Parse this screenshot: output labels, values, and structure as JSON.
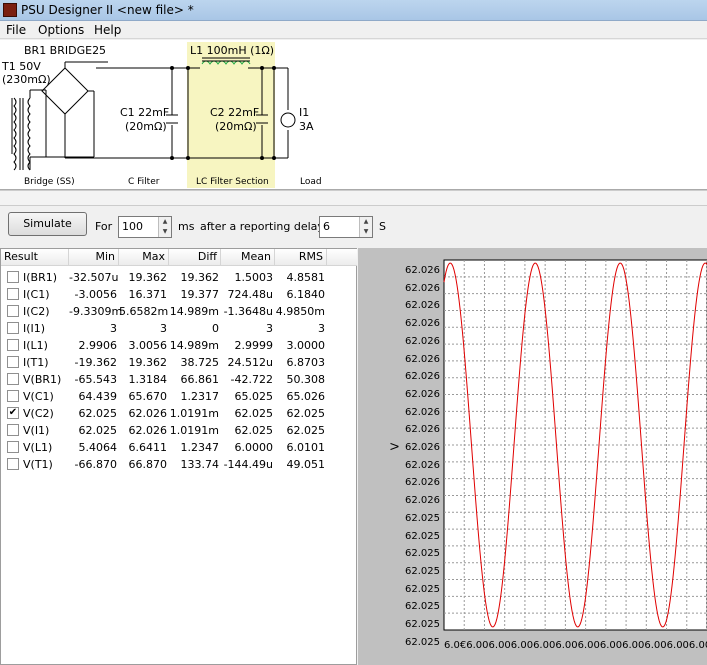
{
  "window": {
    "title": "PSU Designer II  <new file> *"
  },
  "menu": [
    "File",
    "Options",
    "Help"
  ],
  "schematic": {
    "rectifier": "BR1 BRIDGE25",
    "transformer": "T1 50V",
    "transformer_res": "(230mΩ)",
    "inductor": "L1 100mH (1Ω)",
    "c1": "C1 22mF",
    "c1_res": "(20mΩ)",
    "c2": "C2 22mF",
    "c2_res": "(20mΩ)",
    "load": "I1",
    "load_val": "3A",
    "sections": [
      "Bridge (SS)",
      "C Filter",
      "LC Filter Section",
      "Load"
    ]
  },
  "toolbar": {
    "simulate_label": "Simulate",
    "for_label": "For",
    "duration": "100",
    "ms_label": "ms",
    "delay_label": "after a reporting delay of",
    "delay": "6",
    "s_label": "S"
  },
  "table": {
    "headers": [
      "Result",
      "Min",
      "Max",
      "Diff",
      "Mean",
      "RMS"
    ],
    "rows": [
      {
        "name": "I(BR1)",
        "min": "-32.507u",
        "max": "19.362",
        "diff": "19.362",
        "mean": "1.5003",
        "rms": "4.8581",
        "checked": false
      },
      {
        "name": "I(C1)",
        "min": "-3.0056",
        "max": "16.371",
        "diff": "19.377",
        "mean": "724.48u",
        "rms": "6.1840",
        "checked": false
      },
      {
        "name": "I(C2)",
        "min": "-9.3309m",
        "max": "5.6582m",
        "diff": "14.989m",
        "mean": "-1.3648u",
        "rms": "4.9850m",
        "checked": false
      },
      {
        "name": "I(I1)",
        "min": "3",
        "max": "3",
        "diff": "0",
        "mean": "3",
        "rms": "3",
        "checked": false
      },
      {
        "name": "I(L1)",
        "min": "2.9906",
        "max": "3.0056",
        "diff": "14.989m",
        "mean": "2.9999",
        "rms": "3.0000",
        "checked": false
      },
      {
        "name": "I(T1)",
        "min": "-19.362",
        "max": "19.362",
        "diff": "38.725",
        "mean": "24.512u",
        "rms": "6.8703",
        "checked": false
      },
      {
        "name": "V(BR1)",
        "min": "-65.543",
        "max": "1.3184",
        "diff": "66.861",
        "mean": "-42.722",
        "rms": "50.308",
        "checked": false
      },
      {
        "name": "V(C1)",
        "min": "64.439",
        "max": "65.670",
        "diff": "1.2317",
        "mean": "65.025",
        "rms": "65.026",
        "checked": false
      },
      {
        "name": "V(C2)",
        "min": "62.025",
        "max": "62.026",
        "diff": "1.0191m",
        "mean": "62.025",
        "rms": "62.025",
        "checked": true
      },
      {
        "name": "V(I1)",
        "min": "62.025",
        "max": "62.026",
        "diff": "1.0191m",
        "mean": "62.025",
        "rms": "62.025",
        "checked": false
      },
      {
        "name": "V(L1)",
        "min": "5.4064",
        "max": "6.6411",
        "diff": "1.2347",
        "mean": "6.0000",
        "rms": "6.0101",
        "checked": false
      },
      {
        "name": "V(T1)",
        "min": "-66.870",
        "max": "66.870",
        "diff": "133.74",
        "mean": "-144.49u",
        "rms": "49.051",
        "checked": false
      }
    ]
  },
  "plot": {
    "ylabel": "V",
    "y_ticks": [
      "62.026",
      "62.026",
      "62.026",
      "62.026",
      "62.026",
      "62.026",
      "62.026",
      "62.026",
      "62.026",
      "62.026",
      "62.026",
      "62.026",
      "62.026",
      "62.026",
      "62.025",
      "62.025",
      "62.025",
      "62.025",
      "62.025",
      "62.025",
      "62.025",
      "62.025"
    ],
    "x_ticks_text": "6.0€6.006.006.006.006.006.006.006.006.006.006.006.006.00"
  },
  "colors": {
    "trace": "#e00000",
    "plot_bg": "#ffffff",
    "panel_bg": "#c0c0c0",
    "lc_highlight": "#f7f5c1"
  }
}
